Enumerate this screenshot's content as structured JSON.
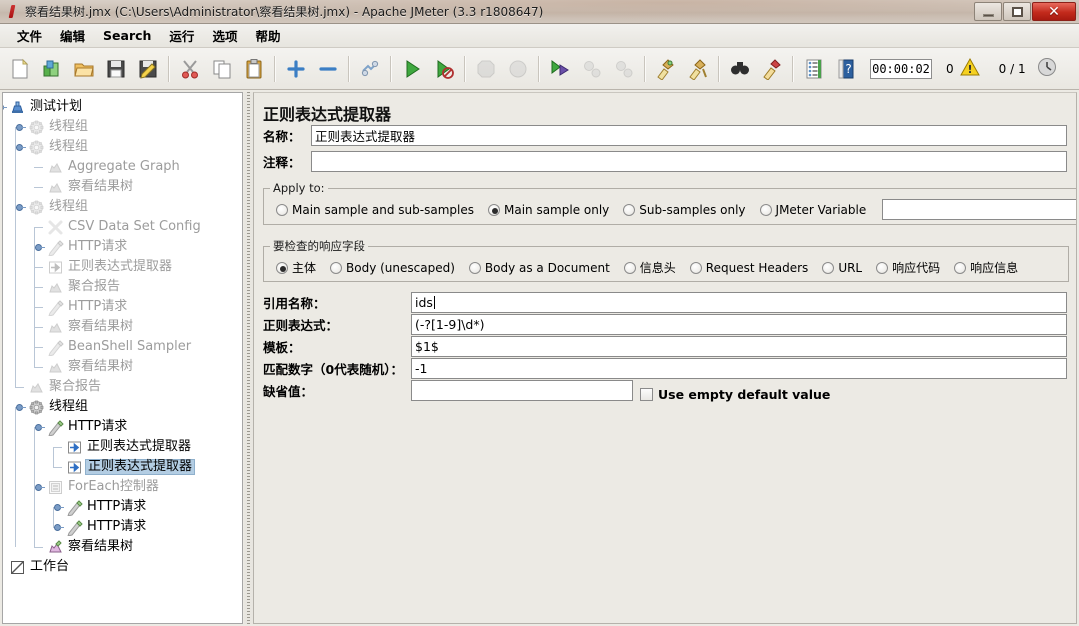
{
  "window": {
    "title": "察看结果树.jmx (C:\\Users\\Administrator\\察看结果树.jmx) - Apache JMeter (3.3 r1808647)",
    "app_icon": "jmeter-icon",
    "minimize_label": "–",
    "maximize_label": "▢",
    "close_label": "✕"
  },
  "menubar": {
    "items": [
      {
        "label": "文件",
        "name": "menu-file"
      },
      {
        "label": "编辑",
        "name": "menu-edit"
      },
      {
        "label": "Search",
        "name": "menu-search"
      },
      {
        "label": "运行",
        "name": "menu-run"
      },
      {
        "label": "选项",
        "name": "menu-options"
      },
      {
        "label": "帮助",
        "name": "menu-help"
      }
    ]
  },
  "toolbar": {
    "buttons": [
      {
        "name": "new-button",
        "icon": "new-document-icon",
        "enabled": true
      },
      {
        "name": "templates-button",
        "icon": "templates-icon",
        "enabled": true
      },
      {
        "name": "open-button",
        "icon": "open-folder-icon",
        "enabled": true
      },
      {
        "name": "save-button",
        "icon": "save-floppy-icon",
        "enabled": true
      },
      {
        "name": "save-as-button",
        "icon": "save-as-icon",
        "enabled": true
      },
      {
        "name": "cut-button",
        "icon": "scissors-icon",
        "enabled": true
      },
      {
        "name": "copy-button",
        "icon": "copy-icon",
        "enabled": true
      },
      {
        "name": "paste-button",
        "icon": "clipboard-paste-icon",
        "enabled": true
      },
      {
        "name": "expand-all-button",
        "icon": "plus-icon",
        "enabled": true
      },
      {
        "name": "collapse-all-button",
        "icon": "minus-icon",
        "enabled": true
      },
      {
        "name": "toggle-button",
        "icon": "toggle-icon",
        "enabled": true
      },
      {
        "name": "start-button",
        "icon": "play-green-icon",
        "enabled": true
      },
      {
        "name": "start-no-pauses-button",
        "icon": "play-no-pause-icon",
        "enabled": true
      },
      {
        "name": "stop-button",
        "icon": "stop-octagon-icon",
        "enabled": false
      },
      {
        "name": "shutdown-button",
        "icon": "shutdown-icon",
        "enabled": false
      },
      {
        "name": "start-remote-button",
        "icon": "remote-start-icon",
        "enabled": true
      },
      {
        "name": "stop-remote-button",
        "icon": "remote-stop-icon",
        "enabled": false
      },
      {
        "name": "shutdown-remote-button",
        "icon": "remote-shutdown-icon",
        "enabled": false
      },
      {
        "name": "clear-button",
        "icon": "clear-broom-icon",
        "enabled": true
      },
      {
        "name": "clear-all-button",
        "icon": "clear-all-broom-icon",
        "enabled": true
      },
      {
        "name": "search-button",
        "icon": "binoculars-icon",
        "enabled": true
      },
      {
        "name": "search-reset-button",
        "icon": "broom-reset-icon",
        "enabled": true
      },
      {
        "name": "function-helper-button",
        "icon": "function-list-icon",
        "enabled": true
      },
      {
        "name": "help-button",
        "icon": "help-book-icon",
        "enabled": true
      }
    ],
    "elapsed_time": "00:00:02",
    "errors_count": "0",
    "warn_icon": "warning-triangle-icon",
    "threads_ratio": "0 / 1",
    "clock_icon": "clock-icon"
  },
  "tree": {
    "nodes": [
      {
        "label": "测试计划",
        "icon": "test-plan-icon",
        "depth": 0,
        "disabled": false,
        "selected": false,
        "expander": "expanded"
      },
      {
        "label": "线程组",
        "icon": "thread-group-icon",
        "depth": 1,
        "disabled": true,
        "selected": false,
        "expander": "collapsed"
      },
      {
        "label": "线程组",
        "icon": "thread-group-icon",
        "depth": 1,
        "disabled": true,
        "selected": false,
        "expander": "collapsed"
      },
      {
        "label": "Aggregate Graph",
        "icon": "listener-icon",
        "depth": 2,
        "disabled": true,
        "selected": false,
        "expander": "none"
      },
      {
        "label": "察看结果树",
        "icon": "listener-icon",
        "depth": 2,
        "disabled": true,
        "selected": false,
        "expander": "none"
      },
      {
        "label": "线程组",
        "icon": "thread-group-icon",
        "depth": 1,
        "disabled": true,
        "selected": false,
        "expander": "expanded"
      },
      {
        "label": "CSV Data Set Config",
        "icon": "config-element-icon",
        "depth": 2,
        "disabled": true,
        "selected": false,
        "expander": "none"
      },
      {
        "label": "HTTP请求",
        "icon": "http-sampler-icon",
        "depth": 2,
        "disabled": true,
        "selected": false,
        "expander": "collapsed"
      },
      {
        "label": "正则表达式提取器",
        "icon": "post-processor-icon",
        "depth": 2,
        "disabled": true,
        "selected": false,
        "expander": "none"
      },
      {
        "label": "聚合报告",
        "icon": "listener-icon",
        "depth": 2,
        "disabled": true,
        "selected": false,
        "expander": "none"
      },
      {
        "label": "HTTP请求",
        "icon": "http-sampler-icon",
        "depth": 2,
        "disabled": true,
        "selected": false,
        "expander": "none"
      },
      {
        "label": "察看结果树",
        "icon": "listener-icon",
        "depth": 2,
        "disabled": true,
        "selected": false,
        "expander": "none"
      },
      {
        "label": "BeanShell Sampler",
        "icon": "http-sampler-icon",
        "depth": 2,
        "disabled": true,
        "selected": false,
        "expander": "none"
      },
      {
        "label": "察看结果树",
        "icon": "listener-icon",
        "depth": 2,
        "disabled": true,
        "selected": false,
        "expander": "none"
      },
      {
        "label": "聚合报告",
        "icon": "listener-icon",
        "depth": 1,
        "disabled": true,
        "selected": false,
        "expander": "none"
      },
      {
        "label": "线程组",
        "icon": "thread-group-icon",
        "depth": 1,
        "disabled": false,
        "selected": false,
        "expander": "expanded"
      },
      {
        "label": "HTTP请求",
        "icon": "http-sampler-icon",
        "depth": 2,
        "disabled": false,
        "selected": false,
        "expander": "expanded"
      },
      {
        "label": "正则表达式提取器",
        "icon": "post-processor-icon",
        "depth": 3,
        "disabled": false,
        "selected": false,
        "expander": "none"
      },
      {
        "label": "正则表达式提取器",
        "icon": "post-processor-icon",
        "depth": 3,
        "disabled": false,
        "selected": true,
        "expander": "none"
      },
      {
        "label": "ForEach控制器",
        "icon": "controller-icon",
        "depth": 2,
        "disabled": true,
        "selected": false,
        "expander": "expanded"
      },
      {
        "label": "HTTP请求",
        "icon": "http-sampler-icon",
        "depth": 3,
        "disabled": false,
        "selected": false,
        "expander": "collapsed"
      },
      {
        "label": "HTTP请求",
        "icon": "http-sampler-icon",
        "depth": 3,
        "disabled": false,
        "selected": false,
        "expander": "collapsed"
      },
      {
        "label": "察看结果树",
        "icon": "view-results-tree-icon",
        "depth": 2,
        "disabled": false,
        "selected": false,
        "expander": "none"
      },
      {
        "label": "工作台",
        "icon": "workbench-icon",
        "depth": 0,
        "disabled": false,
        "selected": false,
        "expander": "none"
      }
    ]
  },
  "panel": {
    "title": "正则表达式提取器",
    "name_label": "名称：",
    "name_value": "正则表达式提取器",
    "comment_label": "注释：",
    "comment_value": "",
    "apply_to": {
      "legend": "Apply to:",
      "options": [
        {
          "label": "Main sample and sub-samples",
          "selected": false,
          "name": "radio-main-and-sub"
        },
        {
          "label": "Main sample only",
          "selected": true,
          "name": "radio-main-only"
        },
        {
          "label": "Sub-samples only",
          "selected": false,
          "name": "radio-sub-only"
        },
        {
          "label": "JMeter Variable",
          "selected": false,
          "name": "radio-jmeter-variable"
        }
      ],
      "variable_value": ""
    },
    "response_field": {
      "legend": "要检查的响应字段",
      "options": [
        {
          "label": "主体",
          "selected": true,
          "name": "radio-body"
        },
        {
          "label": "Body (unescaped)",
          "selected": false,
          "name": "radio-body-unescaped"
        },
        {
          "label": "Body as a Document",
          "selected": false,
          "name": "radio-body-as-document"
        },
        {
          "label": "信息头",
          "selected": false,
          "name": "radio-response-headers"
        },
        {
          "label": "Request Headers",
          "selected": false,
          "name": "radio-request-headers"
        },
        {
          "label": "URL",
          "selected": false,
          "name": "radio-url"
        },
        {
          "label": "响应代码",
          "selected": false,
          "name": "radio-response-code"
        },
        {
          "label": "响应信息",
          "selected": false,
          "name": "radio-response-message"
        }
      ]
    },
    "fields": [
      {
        "label": "引用名称：",
        "value": "ids",
        "name": "reference-name",
        "caret": true
      },
      {
        "label": "正则表达式：",
        "value": "(-?[1-9]\\d*)",
        "name": "regular-expression",
        "caret": false
      },
      {
        "label": "模板：",
        "value": "$1$",
        "name": "template",
        "caret": false
      },
      {
        "label": "匹配数字（0代表随机）：",
        "value": "-1",
        "name": "match-number",
        "caret": false
      },
      {
        "label": "缺省值：",
        "value": "",
        "name": "default-value",
        "caret": false
      }
    ],
    "use_empty_default": {
      "label": "Use empty default value",
      "checked": false
    }
  },
  "colors": {
    "selection": "#b3cde3",
    "titlebar_close": "#c32a1c",
    "panel_bg": "#eceae4",
    "tree_bg": "#ffffff",
    "disabled_text": "#9c9c9c"
  }
}
